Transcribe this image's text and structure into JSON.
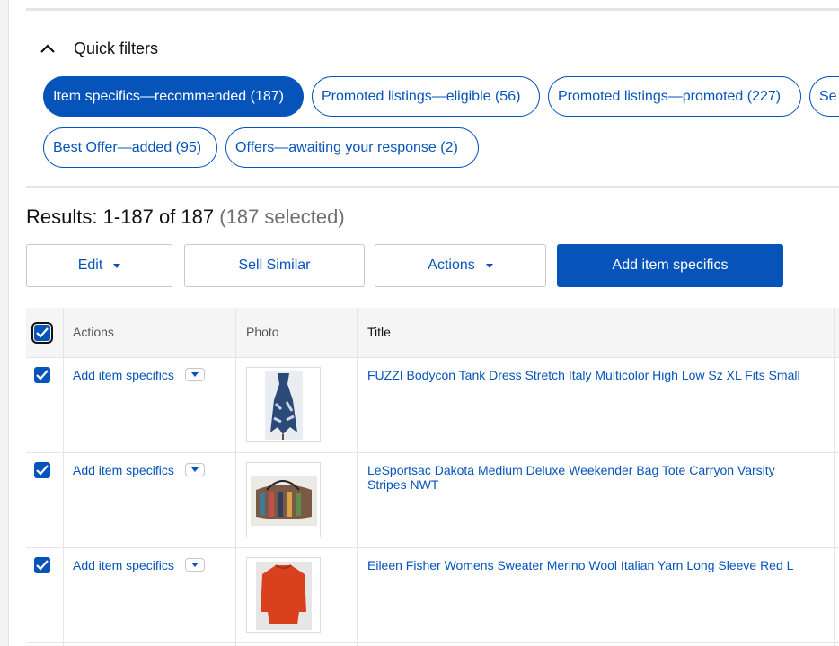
{
  "quick_filters": {
    "title": "Quick filters",
    "pills": [
      {
        "label": "Item specifics—recommended (187)",
        "active": true
      },
      {
        "label": "Promoted listings—eligible (56)",
        "active": false
      },
      {
        "label": "Promoted listings—promoted (227)",
        "active": false
      },
      {
        "label": "Se",
        "active": false
      },
      {
        "label": "Best Offer—added (95)",
        "active": false
      },
      {
        "label": "Offers—awaiting your response (2)",
        "active": false
      }
    ]
  },
  "results": {
    "text": "Results: 1-187 of 187",
    "selected": "(187 selected)"
  },
  "toolbar": {
    "edit_label": "Edit",
    "sell_similar_label": "Sell Similar",
    "actions_label": "Actions",
    "add_specifics_label": "Add item specifics"
  },
  "table": {
    "headers": {
      "actions": "Actions",
      "photo": "Photo",
      "title": "Title"
    },
    "rows": [
      {
        "action": "Add item specifics",
        "title": "FUZZI Bodycon Tank Dress Stretch Italy Multicolor High Low Sz XL Fits Small",
        "checked": true
      },
      {
        "action": "Add item specifics",
        "title": "LeSportsac Dakota Medium Deluxe Weekender Bag Tote Carryon Varsity Stripes NWT",
        "checked": true
      },
      {
        "action": "Add item specifics",
        "title": "Eileen Fisher Womens Sweater Merino Wool Italian Yarn Long Sleeve Red L",
        "checked": true
      }
    ]
  },
  "colors": {
    "accent": "#0654ba"
  }
}
